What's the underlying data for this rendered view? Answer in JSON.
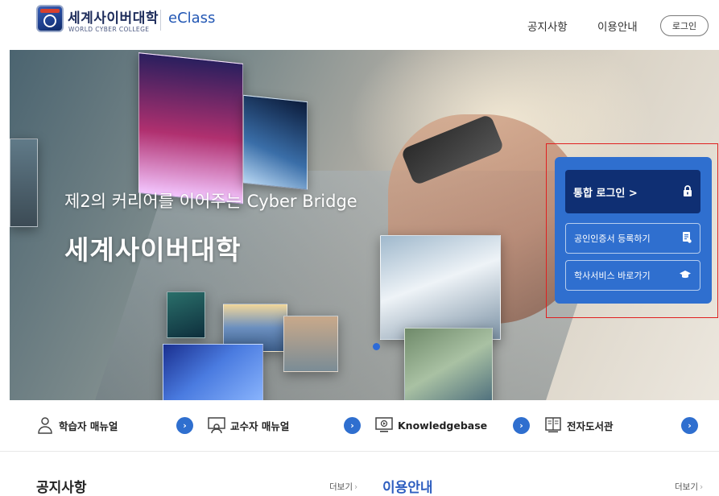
{
  "header": {
    "logo_name_ko": "세계사이버대학",
    "logo_name_en": "WORLD CYBER COLLEGE",
    "logo_product": "eClass",
    "nav": [
      {
        "label": "공지사항"
      },
      {
        "label": "이용안내"
      }
    ],
    "login_label": "로그인"
  },
  "hero": {
    "subtitle": "제2의 커리어를 이어주는 Cyber Bridge",
    "title": "세계사이버대학",
    "slide_indicator_color": "#2d6bd8"
  },
  "login_panel": {
    "background": "#2f6fcf",
    "buttons": [
      {
        "label": "통합 로그인 >",
        "icon": "lock-icon"
      },
      {
        "label": "공인인증서 등록하기",
        "icon": "certificate-document-icon"
      },
      {
        "label": "학사서비스 바로가기",
        "icon": "graduation-cap-icon"
      }
    ]
  },
  "quick_links": [
    {
      "label": "학습자 매뉴얼",
      "icon": "student-person-icon"
    },
    {
      "label": "교수자 매뉴얼",
      "icon": "professor-board-icon"
    },
    {
      "label": "Knowledgebase",
      "icon": "monitor-play-icon"
    },
    {
      "label": "전자도서관",
      "icon": "book-library-icon"
    }
  ],
  "sections": [
    {
      "title": "공지사항",
      "more_label": "더보기"
    },
    {
      "title": "이용안내",
      "more_label": "더보기"
    }
  ],
  "colors": {
    "accent": "#2f6fcf",
    "login_primary": "#0f2f73",
    "highlight": "#e02020"
  }
}
